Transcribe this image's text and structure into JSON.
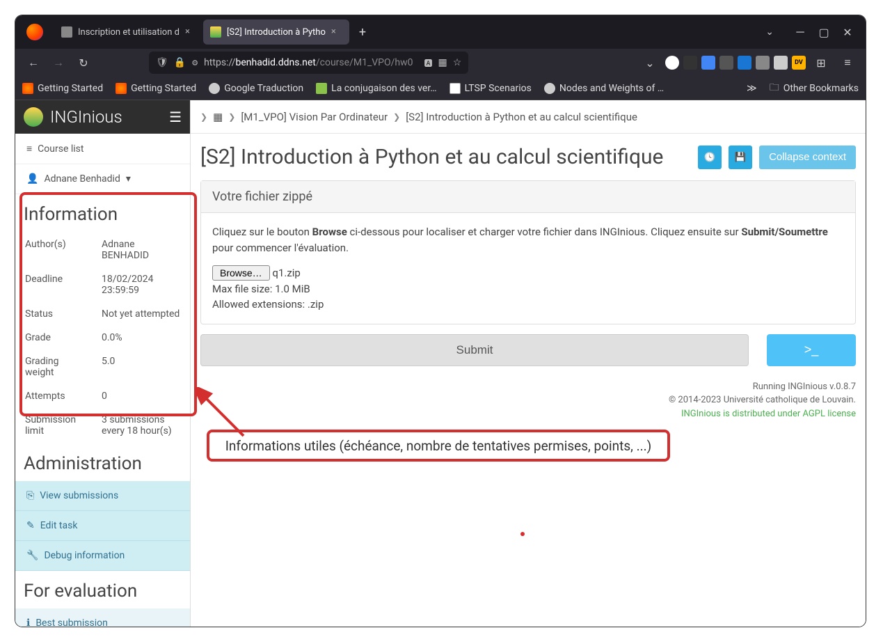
{
  "tabs": [
    {
      "title": "Inscription et utilisation d"
    },
    {
      "title": "[S2] Introduction à Pytho"
    }
  ],
  "urlbar": {
    "domain": "benhadid.ddns.net",
    "path": "/course/M1_VPO/hw0",
    "prefix": "https://"
  },
  "bookmarks": [
    {
      "label": "Getting Started"
    },
    {
      "label": "Getting Started"
    },
    {
      "label": "Google Traduction"
    },
    {
      "label": "La conjugaison des ver…"
    },
    {
      "label": "LTSP Scenarios"
    },
    {
      "label": "Nodes and Weights of …"
    }
  ],
  "other_bookmarks": "Other Bookmarks",
  "brand": "INGInious",
  "sidebar": {
    "course_list": "Course list",
    "user": "Adnane Benhadid",
    "info_heading": "Information",
    "info": [
      {
        "k": "Author(s)",
        "v": "Adnane BENHADID"
      },
      {
        "k": "Deadline",
        "v": "18/02/2024 23:59:59"
      },
      {
        "k": "Status",
        "v": "Not yet attempted"
      },
      {
        "k": "Grade",
        "v": "0.0%"
      },
      {
        "k": "Grading weight",
        "v": "5.0"
      },
      {
        "k": "Attempts",
        "v": "0"
      },
      {
        "k": "Submission limit",
        "v": "3 submissions every 18 hour(s)"
      }
    ],
    "admin_heading": "Administration",
    "admin_links": [
      "View submissions",
      "Edit task",
      "Debug information"
    ],
    "eval_heading": "For evaluation",
    "eval_links": [
      "Best submission"
    ]
  },
  "breadcrumb": {
    "course": "[M1_VPO] Vision Par Ordinateur",
    "task": "[S2] Introduction à Python et au calcul scientifique"
  },
  "page_title": "[S2] Introduction à Python et au calcul scientifique",
  "collapse_label": "Collapse context",
  "upload": {
    "card_title": "Votre fichier zippé",
    "text1": "Cliquez sur le bouton ",
    "browse_bold": "Browse",
    "text2": " ci-dessous pour localiser et charger votre fichier dans INGInious. Cliquez ensuite sur ",
    "submit_bold": "Submit/Soumettre",
    "text3": " pour commencer l'évaluation.",
    "browse_btn": "Browse…",
    "filename": "q1.zip",
    "maxsize": "Max file size: 1.0 MiB",
    "allowed": "Allowed extensions: .zip"
  },
  "submit_label": "Submit",
  "footer": {
    "l1": "Running INGInious v.0.8.7",
    "l2": "© 2014-2023 Université catholique de Louvain.",
    "l3": "INGInious is distributed under AGPL license"
  },
  "callout": "Informations utiles (échéance, nombre de tentatives permises, points, ...)"
}
